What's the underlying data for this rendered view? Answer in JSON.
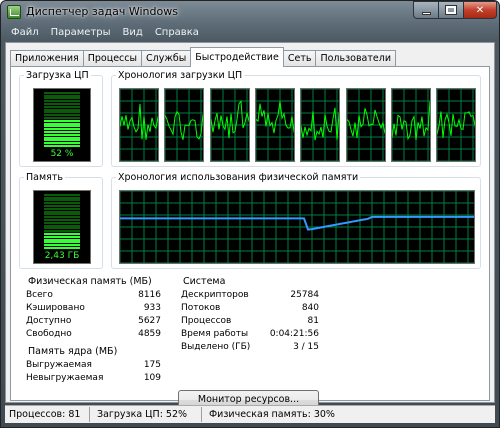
{
  "window": {
    "title": "Диспетчер задач Windows"
  },
  "menu": [
    "Файл",
    "Параметры",
    "Вид",
    "Справка"
  ],
  "tabs": [
    {
      "label": "Приложения",
      "active": false
    },
    {
      "label": "Процессы",
      "active": false
    },
    {
      "label": "Службы",
      "active": false
    },
    {
      "label": "Быстродействие",
      "active": true
    },
    {
      "label": "Сеть",
      "active": false
    },
    {
      "label": "Пользователи",
      "active": false
    }
  ],
  "cpu": {
    "usage_label": "Загрузка ЦП",
    "usage_value": "52 %",
    "usage_fraction": 0.52,
    "history_label": "Хронология загрузки ЦП",
    "core_count": 8
  },
  "memory": {
    "label": "Память",
    "value": "2,43 ГБ",
    "usage_fraction": 0.3,
    "history_label": "Хронология использования физической памяти"
  },
  "physical_memory": {
    "label": "Физическая память (МБ)",
    "rows": [
      {
        "name": "Всего",
        "value": "8116"
      },
      {
        "name": "Кэшировано",
        "value": "933"
      },
      {
        "name": "Доступно",
        "value": "5627"
      },
      {
        "name": "Свободно",
        "value": "4859"
      }
    ]
  },
  "kernel_memory": {
    "label": "Память ядра (МБ)",
    "rows": [
      {
        "name": "Выгружаемая",
        "value": "175"
      },
      {
        "name": "Невыгружаемая",
        "value": "109"
      }
    ]
  },
  "system": {
    "label": "Система",
    "rows": [
      {
        "name": "Дескрипторов",
        "value": "25784"
      },
      {
        "name": "Потоков",
        "value": "840"
      },
      {
        "name": "Процессов",
        "value": "81"
      },
      {
        "name": "Время работы",
        "value": "0:04:21:56"
      },
      {
        "name": "Выделено (ГБ)",
        "value": "3 / 15"
      }
    ]
  },
  "buttons": {
    "resource_monitor": "Монитор ресурсов..."
  },
  "status": {
    "processes": "Процессов: 81",
    "cpu": "Загрузка ЦП: 52%",
    "memory": "Физическая память: 30%"
  },
  "colors": {
    "graph_bg": "#000000",
    "grid": "#008040",
    "cpu_line": "#00ff00",
    "mem_line": "#3399ff",
    "meter_on": "#35ff35",
    "meter_off": "#0a5a0a"
  }
}
